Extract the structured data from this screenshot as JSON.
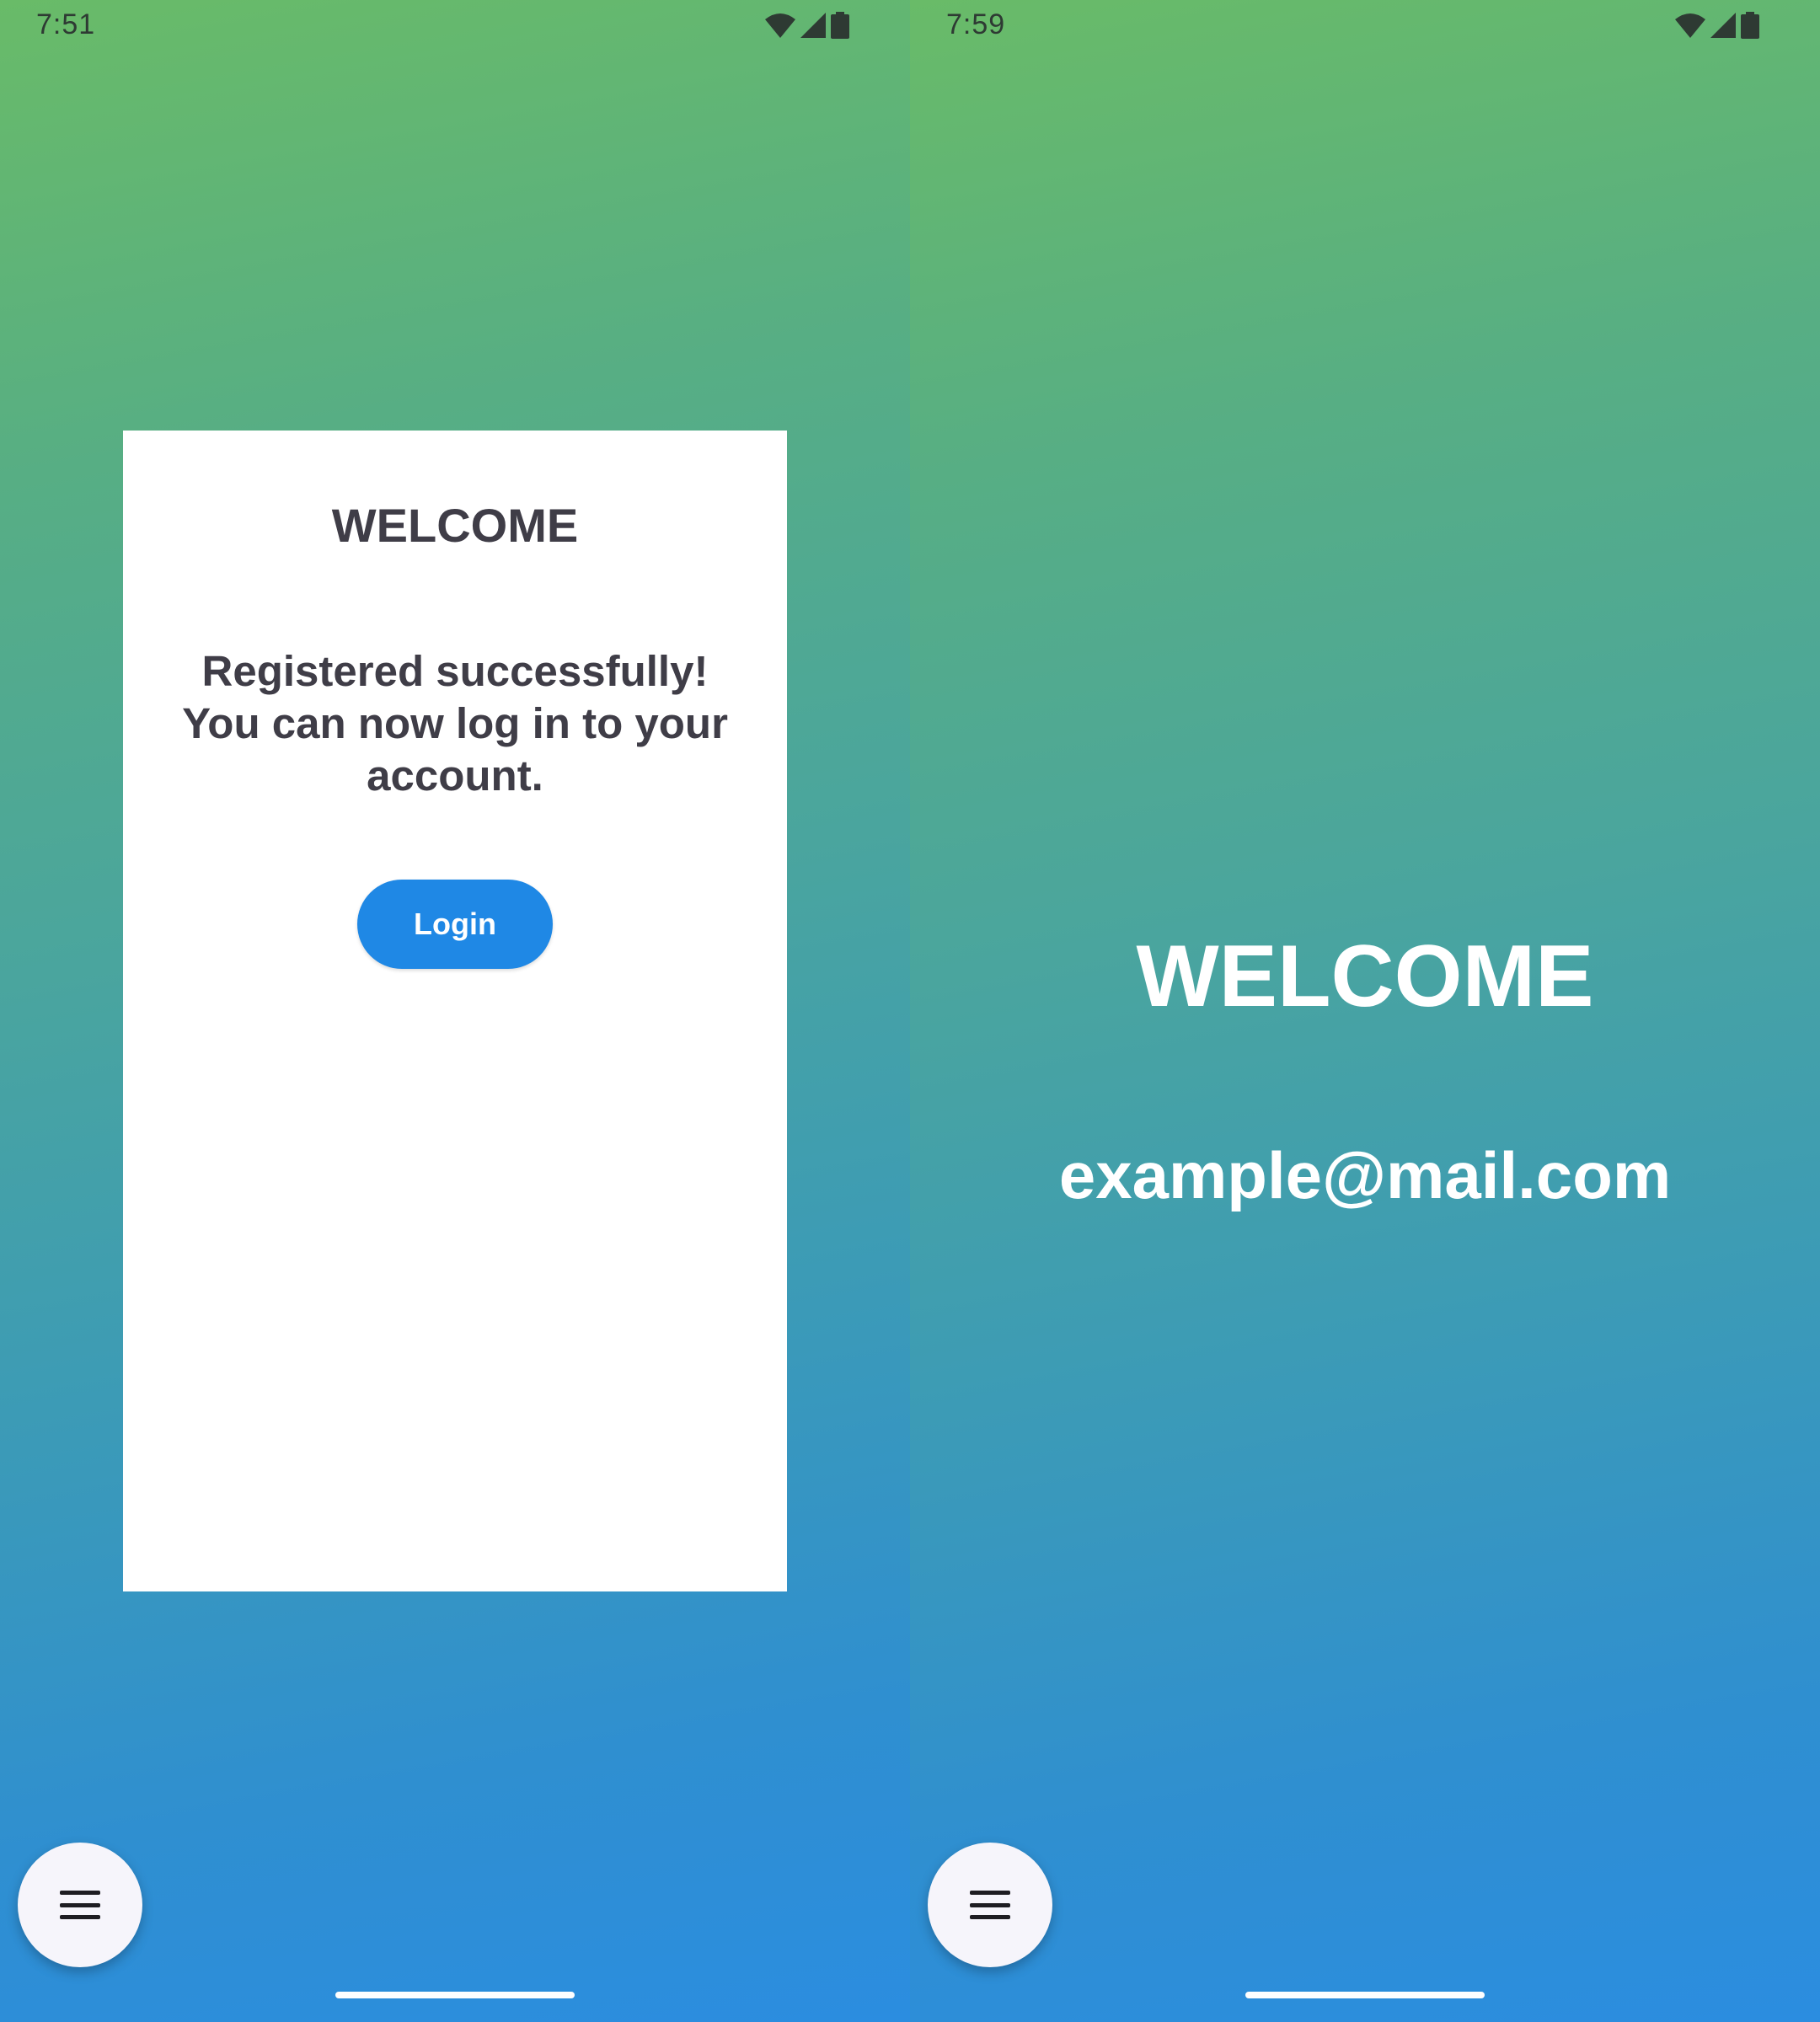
{
  "left_screen": {
    "status_bar": {
      "time": "7:51"
    },
    "card": {
      "title": "WELCOME",
      "message": "Registered successfully! You can now log in to your account.",
      "login_button_label": "Login"
    },
    "fab_icon": "menu-icon"
  },
  "right_screen": {
    "status_bar": {
      "time": "7:59"
    },
    "title": "WELCOME",
    "email": "example@mail.com",
    "fab_icon": "menu-icon"
  },
  "status_icons": [
    "wifi-icon",
    "cell-signal-icon",
    "battery-icon"
  ],
  "colors": {
    "gradient_top": "#69bb68",
    "gradient_bottom": "#2b8de0",
    "primary_button": "#1f88e5",
    "card_text": "#3f3d47",
    "fab_background": "#f6f5fb"
  }
}
